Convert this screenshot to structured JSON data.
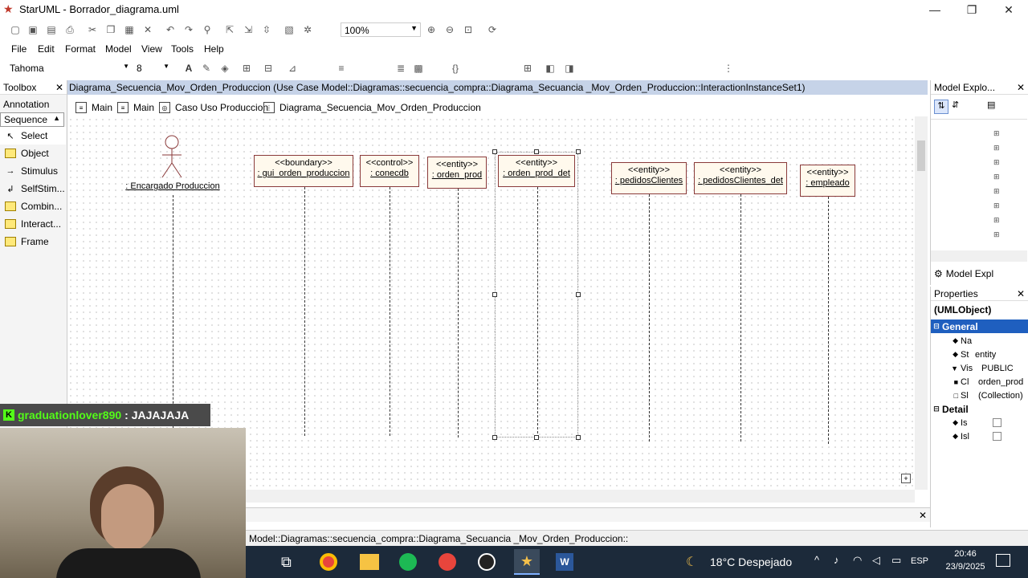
{
  "window": {
    "title": "StarUML - Borrador_diagrama.uml",
    "controls": {
      "minimize": "—",
      "maximize": "❐",
      "close": "✕"
    }
  },
  "menu": [
    "File",
    "Edit",
    "Format",
    "Model",
    "View",
    "Tools",
    "Help"
  ],
  "toolbar": {
    "zoom_value": "100%",
    "font_name": "Tahoma",
    "font_size": "8"
  },
  "toolbox": {
    "title": "Toolbox",
    "annotation_label": "Annotation",
    "sequence_label": "Sequence",
    "items": [
      "Select",
      "Object",
      "Stimulus",
      "SelfStim...",
      "Combin...",
      "Interact...",
      "Frame"
    ]
  },
  "diagram": {
    "header": "Diagrama_Secuencia_Mov_Orden_Produccion (Use Case Model::Diagramas::secuencia_compra::Diagrama_Secuancia _Mov_Orden_Produccion::InteractionInstanceSet1)",
    "tabs": [
      "Main",
      "Main",
      "Caso Uso Produccion",
      "Diagrama_Secuencia_Mov_Orden_Produccion"
    ],
    "actor_name": ": Encargado Produccion",
    "lifelines": [
      {
        "stereotype": "<<boundary>>",
        "name": ": gui_orden_produccion"
      },
      {
        "stereotype": "<<control>>",
        "name": ": conecdb"
      },
      {
        "stereotype": "<<entity>>",
        "name": ": orden_prod"
      },
      {
        "stereotype": "<<entity>>",
        "name": ": orden_prod_det"
      },
      {
        "stereotype": "<<entity>>",
        "name": ": pedidosClientes"
      },
      {
        "stereotype": "<<entity>>",
        "name": ": pedidosClientes_det"
      },
      {
        "stereotype": "<<entity>>",
        "name": ": empleado"
      }
    ]
  },
  "model_explorer": {
    "title": "Model Explo...",
    "tab_label": "Model Expl"
  },
  "properties": {
    "title": "Properties",
    "type": "(UMLObject)",
    "section_general": "General",
    "section_detail": "Detail",
    "rows": [
      {
        "key": "Na",
        "value": ""
      },
      {
        "key": "St",
        "value": "entity"
      },
      {
        "key": "Vis",
        "value": "PUBLIC"
      },
      {
        "key": "Cl",
        "value": "orden_prod"
      },
      {
        "key": "Sl",
        "value": "(Collection)"
      }
    ],
    "detail_rows": [
      "Is",
      "Isl"
    ]
  },
  "status": "Model::Diagramas::secuencia_compra::Diagrama_Secuancia _Mov_Orden_Produccion::",
  "chat": {
    "user": "graduationlover890",
    "message": ": JAJAJAJA"
  },
  "taskbar": {
    "weather": "18°C Despejado",
    "lang": "ESP",
    "time": "20:46",
    "date": "23/9/2025"
  }
}
